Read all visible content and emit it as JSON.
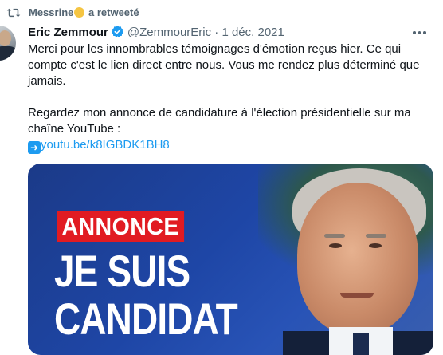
{
  "retweet": {
    "user": "Messrine",
    "emoji": "face-with-hand-over-mouth-emoji",
    "suffix": "a retweeté"
  },
  "tweet": {
    "author_name": "Eric Zemmour",
    "handle": "@ZemmourEric",
    "separator": "·",
    "date": "1 déc. 2021",
    "text_paragraph_1": "Merci pour les innombrables témoignages d'émotion reçus hier. Ce qui compte c'est le lien direct entre nous. Vous me rendez plus déterminé que jamais.",
    "text_paragraph_2": "Regardez mon annonce de candidature à l'élection présidentielle sur ma chaîne YouTube :",
    "link_emoji": "right-arrow-emoji",
    "link_text": "youtu.be/k8IGBDK1BH8"
  },
  "media": {
    "badge": "ANNONCE",
    "headline_line1": "JE SUIS",
    "headline_line2": "CANDIDAT"
  },
  "colors": {
    "link": "#1d9bf0",
    "secondary_text": "#536471",
    "verified": "#1d9bf0",
    "badge_red": "#e11b22",
    "media_blue": "#1e46a6"
  },
  "icons": {
    "retweet": "retweet-icon",
    "verified": "verified-badge-icon",
    "more": "more-options-icon"
  }
}
